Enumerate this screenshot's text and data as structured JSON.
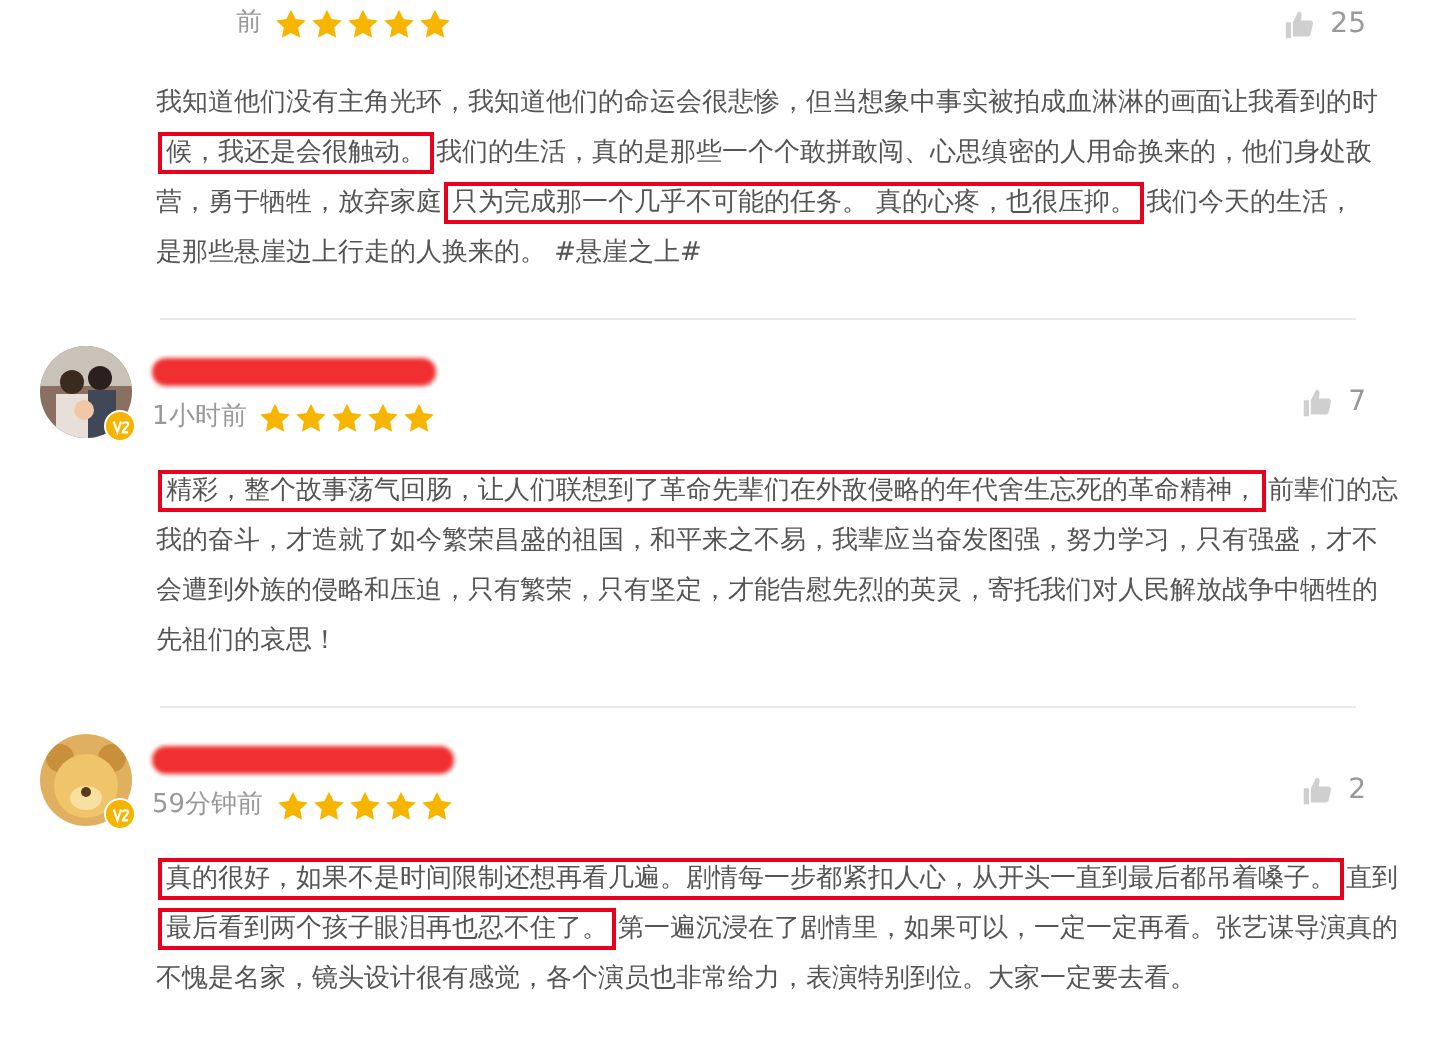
{
  "comments": [
    {
      "has_avatar": false,
      "time": "前",
      "stars": 5,
      "likes": "25",
      "lines": [
        [
          {
            "text": "我知道他们没有主角光环，我知道他们的命运会很悲惨，但当想象中事实被拍成血淋淋的画面让我看到的时",
            "highlighted": false
          }
        ],
        [
          {
            "text": "候，我还是会很触动。",
            "highlighted": true
          },
          {
            "text": "我们的生活，真的是那些一个个敢拼敢闯、心思缜密的人用命换来的，他们身处敌",
            "highlighted": false
          }
        ],
        [
          {
            "text": "营，勇于牺牲，放弃家庭",
            "highlighted": false
          },
          {
            "text": "只为完成那一个几乎不可能的任务。 真的心疼，也很压抑。",
            "highlighted": true
          },
          {
            "text": "我们今天的生活，",
            "highlighted": false
          }
        ],
        [
          {
            "text": "是那些悬崖边上行走的人换来的。 #悬崖之上#",
            "highlighted": false
          }
        ]
      ]
    },
    {
      "has_avatar": true,
      "time": "1小时前",
      "stars": 5,
      "likes": "7",
      "lines": [
        [
          {
            "text": "精彩，整个故事荡气回肠，让人们联想到了革命先辈们在外敌侵略的年代舍生忘死的革命精神，",
            "highlighted": true
          },
          {
            "text": "前辈们的忘",
            "highlighted": false
          }
        ],
        [
          {
            "text": "我的奋斗，才造就了如今繁荣昌盛的祖国，和平来之不易，我辈应当奋发图强，努力学习，只有强盛，才不",
            "highlighted": false
          }
        ],
        [
          {
            "text": "会遭到外族的侵略和压迫，只有繁荣，只有坚定，才能告慰先烈的英灵，寄托我们对人民解放战争中牺牲的",
            "highlighted": false
          }
        ],
        [
          {
            "text": "先祖们的哀思！",
            "highlighted": false
          }
        ]
      ]
    },
    {
      "has_avatar": true,
      "time": "59分钟前",
      "stars": 5,
      "likes": "2",
      "lines": [
        [
          {
            "text": "真的很好，如果不是时间限制还想再看几遍。剧情每一步都紧扣人心，从开头一直到最后都吊着嗓子。",
            "highlighted": true
          },
          {
            "text": "直到",
            "highlighted": false
          }
        ],
        [
          {
            "text": "最后看到两个孩子眼泪再也忍不住了。",
            "highlighted": true
          },
          {
            "text": "第一遍沉浸在了剧情里，如果可以，一定一定再看。张艺谋导演真的",
            "highlighted": false
          }
        ],
        [
          {
            "text": "不愧是名家，镜头设计很有感觉，各个演员也非常给力，表演特别到位。大家一定要去看。",
            "highlighted": false
          }
        ]
      ]
    }
  ]
}
